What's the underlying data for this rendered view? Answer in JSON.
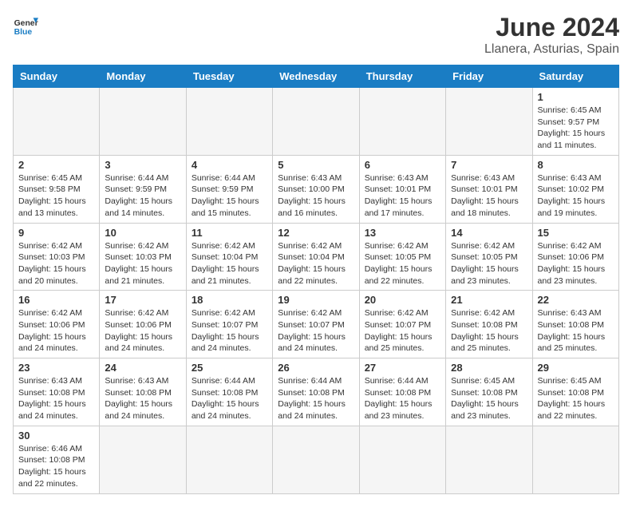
{
  "header": {
    "logo_general": "General",
    "logo_blue": "Blue",
    "month": "June 2024",
    "location": "Llanera, Asturias, Spain"
  },
  "weekdays": [
    "Sunday",
    "Monday",
    "Tuesday",
    "Wednesday",
    "Thursday",
    "Friday",
    "Saturday"
  ],
  "weeks": [
    [
      {
        "day": "",
        "info": ""
      },
      {
        "day": "",
        "info": ""
      },
      {
        "day": "",
        "info": ""
      },
      {
        "day": "",
        "info": ""
      },
      {
        "day": "",
        "info": ""
      },
      {
        "day": "",
        "info": ""
      },
      {
        "day": "1",
        "info": "Sunrise: 6:45 AM\nSunset: 9:57 PM\nDaylight: 15 hours and 11 minutes."
      }
    ],
    [
      {
        "day": "2",
        "info": "Sunrise: 6:45 AM\nSunset: 9:58 PM\nDaylight: 15 hours and 13 minutes."
      },
      {
        "day": "3",
        "info": "Sunrise: 6:44 AM\nSunset: 9:59 PM\nDaylight: 15 hours and 14 minutes."
      },
      {
        "day": "4",
        "info": "Sunrise: 6:44 AM\nSunset: 9:59 PM\nDaylight: 15 hours and 15 minutes."
      },
      {
        "day": "5",
        "info": "Sunrise: 6:43 AM\nSunset: 10:00 PM\nDaylight: 15 hours and 16 minutes."
      },
      {
        "day": "6",
        "info": "Sunrise: 6:43 AM\nSunset: 10:01 PM\nDaylight: 15 hours and 17 minutes."
      },
      {
        "day": "7",
        "info": "Sunrise: 6:43 AM\nSunset: 10:01 PM\nDaylight: 15 hours and 18 minutes."
      },
      {
        "day": "8",
        "info": "Sunrise: 6:43 AM\nSunset: 10:02 PM\nDaylight: 15 hours and 19 minutes."
      }
    ],
    [
      {
        "day": "9",
        "info": "Sunrise: 6:42 AM\nSunset: 10:03 PM\nDaylight: 15 hours and 20 minutes."
      },
      {
        "day": "10",
        "info": "Sunrise: 6:42 AM\nSunset: 10:03 PM\nDaylight: 15 hours and 21 minutes."
      },
      {
        "day": "11",
        "info": "Sunrise: 6:42 AM\nSunset: 10:04 PM\nDaylight: 15 hours and 21 minutes."
      },
      {
        "day": "12",
        "info": "Sunrise: 6:42 AM\nSunset: 10:04 PM\nDaylight: 15 hours and 22 minutes."
      },
      {
        "day": "13",
        "info": "Sunrise: 6:42 AM\nSunset: 10:05 PM\nDaylight: 15 hours and 22 minutes."
      },
      {
        "day": "14",
        "info": "Sunrise: 6:42 AM\nSunset: 10:05 PM\nDaylight: 15 hours and 23 minutes."
      },
      {
        "day": "15",
        "info": "Sunrise: 6:42 AM\nSunset: 10:06 PM\nDaylight: 15 hours and 23 minutes."
      }
    ],
    [
      {
        "day": "16",
        "info": "Sunrise: 6:42 AM\nSunset: 10:06 PM\nDaylight: 15 hours and 24 minutes."
      },
      {
        "day": "17",
        "info": "Sunrise: 6:42 AM\nSunset: 10:06 PM\nDaylight: 15 hours and 24 minutes."
      },
      {
        "day": "18",
        "info": "Sunrise: 6:42 AM\nSunset: 10:07 PM\nDaylight: 15 hours and 24 minutes."
      },
      {
        "day": "19",
        "info": "Sunrise: 6:42 AM\nSunset: 10:07 PM\nDaylight: 15 hours and 24 minutes."
      },
      {
        "day": "20",
        "info": "Sunrise: 6:42 AM\nSunset: 10:07 PM\nDaylight: 15 hours and 25 minutes."
      },
      {
        "day": "21",
        "info": "Sunrise: 6:42 AM\nSunset: 10:08 PM\nDaylight: 15 hours and 25 minutes."
      },
      {
        "day": "22",
        "info": "Sunrise: 6:43 AM\nSunset: 10:08 PM\nDaylight: 15 hours and 25 minutes."
      }
    ],
    [
      {
        "day": "23",
        "info": "Sunrise: 6:43 AM\nSunset: 10:08 PM\nDaylight: 15 hours and 24 minutes."
      },
      {
        "day": "24",
        "info": "Sunrise: 6:43 AM\nSunset: 10:08 PM\nDaylight: 15 hours and 24 minutes."
      },
      {
        "day": "25",
        "info": "Sunrise: 6:44 AM\nSunset: 10:08 PM\nDaylight: 15 hours and 24 minutes."
      },
      {
        "day": "26",
        "info": "Sunrise: 6:44 AM\nSunset: 10:08 PM\nDaylight: 15 hours and 24 minutes."
      },
      {
        "day": "27",
        "info": "Sunrise: 6:44 AM\nSunset: 10:08 PM\nDaylight: 15 hours and 23 minutes."
      },
      {
        "day": "28",
        "info": "Sunrise: 6:45 AM\nSunset: 10:08 PM\nDaylight: 15 hours and 23 minutes."
      },
      {
        "day": "29",
        "info": "Sunrise: 6:45 AM\nSunset: 10:08 PM\nDaylight: 15 hours and 22 minutes."
      }
    ],
    [
      {
        "day": "30",
        "info": "Sunrise: 6:46 AM\nSunset: 10:08 PM\nDaylight: 15 hours and 22 minutes."
      },
      {
        "day": "",
        "info": ""
      },
      {
        "day": "",
        "info": ""
      },
      {
        "day": "",
        "info": ""
      },
      {
        "day": "",
        "info": ""
      },
      {
        "day": "",
        "info": ""
      },
      {
        "day": "",
        "info": ""
      }
    ]
  ]
}
